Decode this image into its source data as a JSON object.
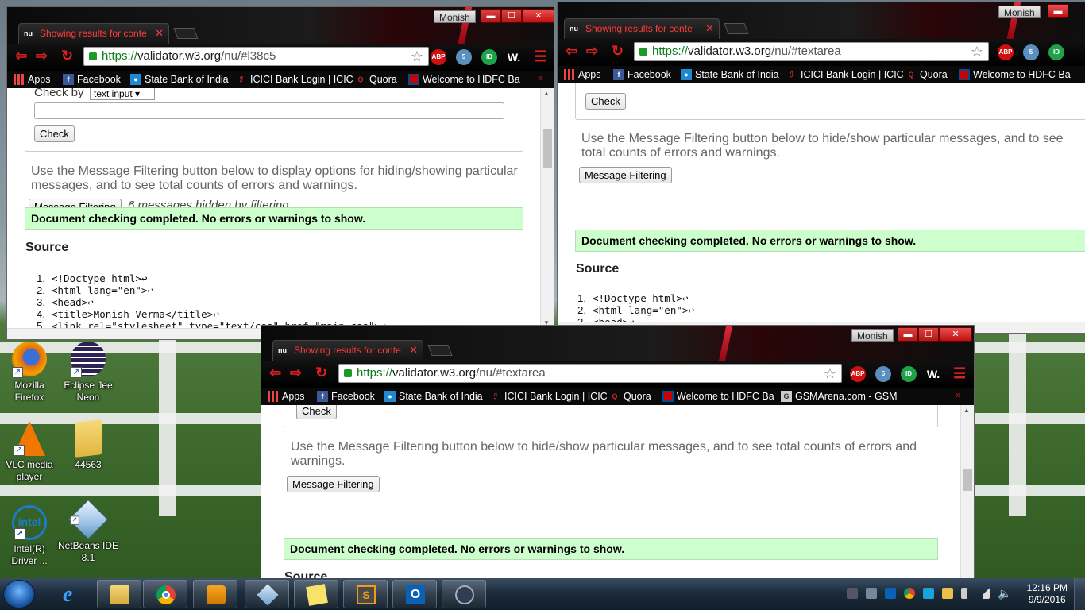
{
  "desktop": {
    "icons": [
      {
        "label": "Mozilla Firefox",
        "line1": "Mozilla",
        "line2": "Firefox",
        "icon": "firefox-icon"
      },
      {
        "label": "Eclipse Jee Neon",
        "line1": "Eclipse Jee",
        "line2": "Neon",
        "icon": "eclipse-icon"
      },
      {
        "label": "VLC media player",
        "line1": "VLC media",
        "line2": "player",
        "icon": "vlc-icon"
      },
      {
        "label": "44563",
        "line1": "44563",
        "line2": "",
        "icon": "folder-icon"
      },
      {
        "label": "Intel(R) Driver ...",
        "line1": "Intel(R)",
        "line2": "Driver ...",
        "icon": "intel-icon"
      },
      {
        "label": "NetBeans IDE 8.1",
        "line1": "NetBeans IDE",
        "line2": "8.1",
        "icon": "netbeans-icon"
      }
    ]
  },
  "browser": {
    "user": "Monish",
    "tab_title": "Showing results for conte",
    "favicon": "nu",
    "controls": {
      "minimize": "▬",
      "maximize": "☐",
      "close": "✕"
    },
    "bookmarks": {
      "apps": "Apps",
      "facebook": "Facebook",
      "sbi": "State Bank of India",
      "icici": "ICICI Bank Login | ICIC",
      "quora": "Quora",
      "hdfc": "Welcome to HDFC Ba",
      "gsmarena": "GSMArena.com - GSM",
      "more": "»"
    },
    "extensions": {
      "abp": "ABP",
      "chromebuild_badge": "5",
      "id": "ID",
      "w": "W."
    }
  },
  "win1": {
    "url_scheme": "https://",
    "url_host": "validator.w3.org",
    "url_path": "/nu/#l38c5",
    "check_by_label": "Check by",
    "check_by_value": "text input",
    "check_button": "Check",
    "filter_text": "Use the Message Filtering button below to display options for hiding/showing particular messages, and to see total counts of errors and warnings.",
    "filter_button": "Message Filtering",
    "hidden_note": "6 messages hidden by filtering",
    "status": "Document checking completed. No errors or warnings to show.",
    "source_heading": "Source",
    "source_lines": [
      {
        "n": "1.",
        "code": "<!Doctype html>↩"
      },
      {
        "n": "2.",
        "code": "<html lang=\"en\">↩"
      },
      {
        "n": "3.",
        "code": "<head>↩"
      },
      {
        "n": "4.",
        "code": "<title>Monish Verma</title>↩"
      },
      {
        "n": "5.",
        "code": "<link rel=\"stylesheet\" type=\"text/css\" href=\"main.css\">↩"
      }
    ]
  },
  "win2": {
    "url_scheme": "https://",
    "url_host": "validator.w3.org",
    "url_path": "/nu/#textarea",
    "check_button": "Check",
    "filter_text": "Use the Message Filtering button below to hide/show particular messages, and to see total counts of errors and warnings.",
    "filter_button": "Message Filtering",
    "status": "Document checking completed. No errors or warnings to show.",
    "source_heading": "Source",
    "source_lines": [
      {
        "n": "1.",
        "code": "<!Doctype html>↩"
      },
      {
        "n": "2.",
        "code": "<html lang=\"en\">↩"
      },
      {
        "n": "3.",
        "code": "<head>↩"
      }
    ]
  },
  "win3": {
    "url_scheme": "https://",
    "url_host": "validator.w3.org",
    "url_path": "/nu/#textarea",
    "check_button": "Check",
    "filter_text": "Use the Message Filtering button below to hide/show particular messages, and to see total counts of errors and warnings.",
    "filter_button": "Message Filtering",
    "status": "Document checking completed. No errors or warnings to show.",
    "source_heading": "Source"
  },
  "taskbar": {
    "apps": [
      "ie-icon",
      "file-explorer-icon",
      "chrome-icon",
      "media-player-icon",
      "virtualbox-icon",
      "sticky-notes-icon",
      "sublime-text-icon",
      "outlook-icon",
      "app-icon"
    ],
    "time": "12:16 PM",
    "date": "9/9/2016"
  }
}
